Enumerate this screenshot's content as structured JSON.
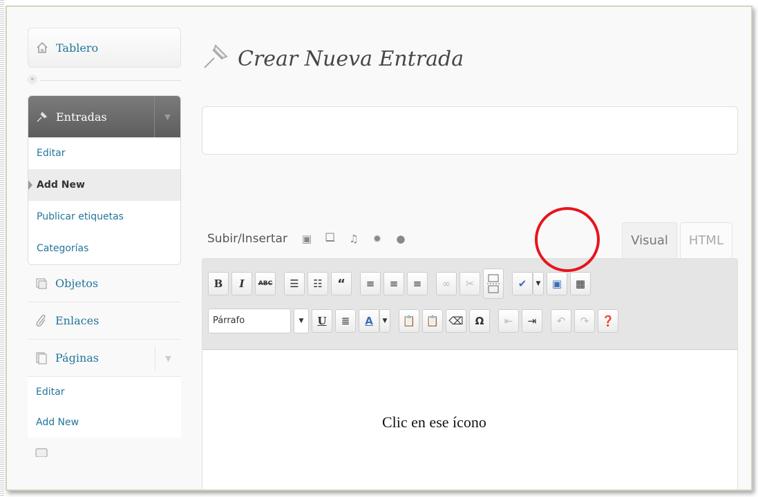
{
  "sidebar": {
    "dashboard": {
      "label": "Tablero",
      "icon": "house-icon"
    },
    "posts": {
      "label": "Entradas",
      "icon": "pushpin-icon",
      "items": [
        {
          "label": "Editar"
        },
        {
          "label": "Add New",
          "current": true
        },
        {
          "label": "Publicar etiquetas"
        },
        {
          "label": "Categorías"
        }
      ]
    },
    "media": {
      "label": "Objetos",
      "icon": "media-icon"
    },
    "links": {
      "label": "Enlaces",
      "icon": "paperclip-icon"
    },
    "pages": {
      "label": "Páginas",
      "icon": "pages-icon",
      "items": [
        {
          "label": "Editar"
        },
        {
          "label": "Add New"
        }
      ]
    }
  },
  "main": {
    "page_title": "Crear Nueva Entrada",
    "upload_label": "Subir/Insertar",
    "tabs": [
      {
        "label": "Visual",
        "active": true
      },
      {
        "label": "HTML",
        "active": false
      }
    ],
    "format_select": "Párrafo",
    "annotation": "Clic en ese ícono"
  },
  "colors": {
    "link": "#21759b",
    "annotation_circle": "#e8141c",
    "active_menu": "#666666"
  }
}
